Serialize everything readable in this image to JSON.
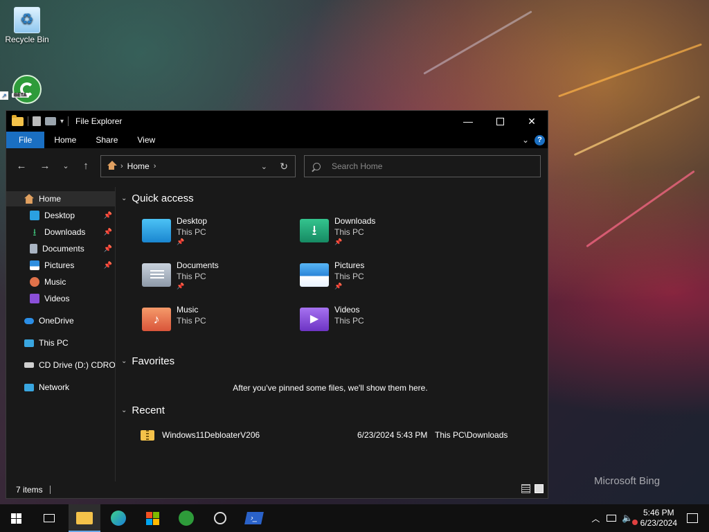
{
  "desktop": {
    "icons": [
      {
        "label": "Recycle Bin"
      },
      {
        "label": ""
      }
    ],
    "brand": "Microsoft Bing"
  },
  "window": {
    "title": "File Explorer",
    "ribbon": {
      "tabs": [
        "File",
        "Home",
        "Share",
        "View"
      ]
    },
    "address": {
      "crumb": "Home"
    },
    "search": {
      "placeholder": "Search Home"
    },
    "sidebar": {
      "items": [
        {
          "label": "Home",
          "icon": "home-icon",
          "pinned": false,
          "selected": true
        },
        {
          "label": "Desktop",
          "icon": "desktop-folder-icon",
          "pinned": true
        },
        {
          "label": "Downloads",
          "icon": "download-icon",
          "pinned": true
        },
        {
          "label": "Documents",
          "icon": "document-icon",
          "pinned": true
        },
        {
          "label": "Pictures",
          "icon": "pictures-icon",
          "pinned": true
        },
        {
          "label": "Music",
          "icon": "music-icon",
          "pinned": false
        },
        {
          "label": "Videos",
          "icon": "videos-icon",
          "pinned": false
        },
        {
          "label": "OneDrive",
          "icon": "cloud-icon",
          "pinned": false
        },
        {
          "label": "This PC",
          "icon": "computer-icon",
          "pinned": false
        },
        {
          "label": "CD Drive (D:) CDROM",
          "icon": "cd-drive-icon",
          "pinned": false
        },
        {
          "label": "Network",
          "icon": "network-icon",
          "pinned": false
        }
      ]
    },
    "quick_access": {
      "header": "Quick access",
      "tiles": [
        {
          "name": "Desktop",
          "location": "This PC",
          "pinned": true,
          "color": "#2aa0e0"
        },
        {
          "name": "Downloads",
          "location": "This PC",
          "pinned": true,
          "color": "#22a37a"
        },
        {
          "name": "Documents",
          "location": "This PC",
          "pinned": true,
          "color": "#a9b4c2"
        },
        {
          "name": "Pictures",
          "location": "This PC",
          "pinned": true,
          "color": "#2f8fe0"
        },
        {
          "name": "Music",
          "location": "This PC",
          "pinned": false,
          "color": "#e0724a"
        },
        {
          "name": "Videos",
          "location": "This PC",
          "pinned": false,
          "color": "#8a4fd8"
        }
      ]
    },
    "favorites": {
      "header": "Favorites",
      "empty_text": "After you've pinned some files, we'll show them here."
    },
    "recent": {
      "header": "Recent",
      "items": [
        {
          "name": "Windows11DebloaterV206",
          "date": "6/23/2024 5:43 PM",
          "location": "This PC\\Downloads"
        }
      ]
    },
    "status": {
      "count": "7 items"
    }
  },
  "taskbar": {
    "clock": {
      "time": "5:46 PM",
      "date": "6/23/2024"
    }
  }
}
